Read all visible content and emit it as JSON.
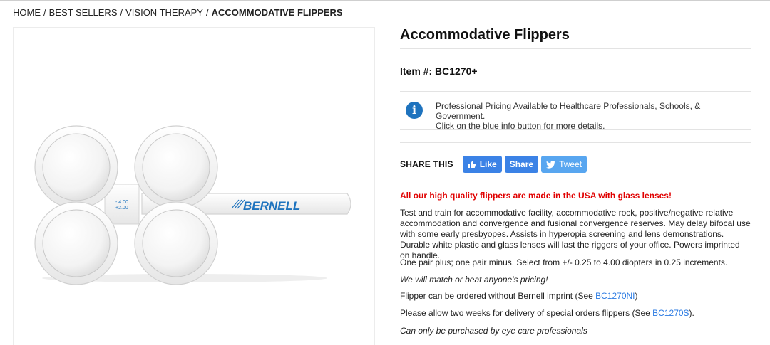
{
  "breadcrumb": {
    "home": "HOME",
    "best_sellers": "BEST SELLERS",
    "vision_therapy": "VISION THERAPY",
    "current": "ACCOMMODATIVE FLIPPERS",
    "separator": "/"
  },
  "product": {
    "title": "Accommodative Flippers",
    "item_label": "Item #:",
    "item_number": "BC1270+",
    "image": {
      "brand": "BERNELL",
      "power_minus": "- 4.00",
      "power_plus": "+2.00"
    }
  },
  "pricing": {
    "icon": "info-icon",
    "line1": "Professional Pricing Available to Healthcare Professionals, Schools, & Government.",
    "line2": "Click on the blue info button for more details."
  },
  "share": {
    "label": "SHARE THIS",
    "like": "Like",
    "share": "Share",
    "tweet": "Tweet"
  },
  "description": {
    "headline": "All our high quality flippers are made in the USA with glass lenses!",
    "body": "Test and train for accommodative facility, accommodative rock, positive/negative relative accommodation and convergence and fusional convergence reserves. May delay bifocal use with some early presbyopes. Assists in hyperopia screening and lens demonstrations. Durable white plastic and glass lenses will last the riggers of your office. Powers imprinted on handle.",
    "pairs": "One pair plus; one pair minus. Select from +/- 0.25 to 4.00 diopters in 0.25 increments.",
    "match": "We will match or beat anyone's pricing!",
    "imprint_text": "Flipper can be ordered without Bernell imprint (See ",
    "imprint_link": "BC1270NI",
    "imprint_end": ")",
    "delivery_text": "Please allow two weeks for delivery of special orders flippers (See ",
    "delivery_link": "BC1270S",
    "delivery_end": ").",
    "restriction": "Can only be purchased by eye care professionals"
  },
  "colors": {
    "accent_blue": "#1e73be",
    "link_blue": "#2a7ae2",
    "alert_red": "#e00000",
    "facebook": "#3b82e6",
    "twitter": "#58a6f0"
  }
}
